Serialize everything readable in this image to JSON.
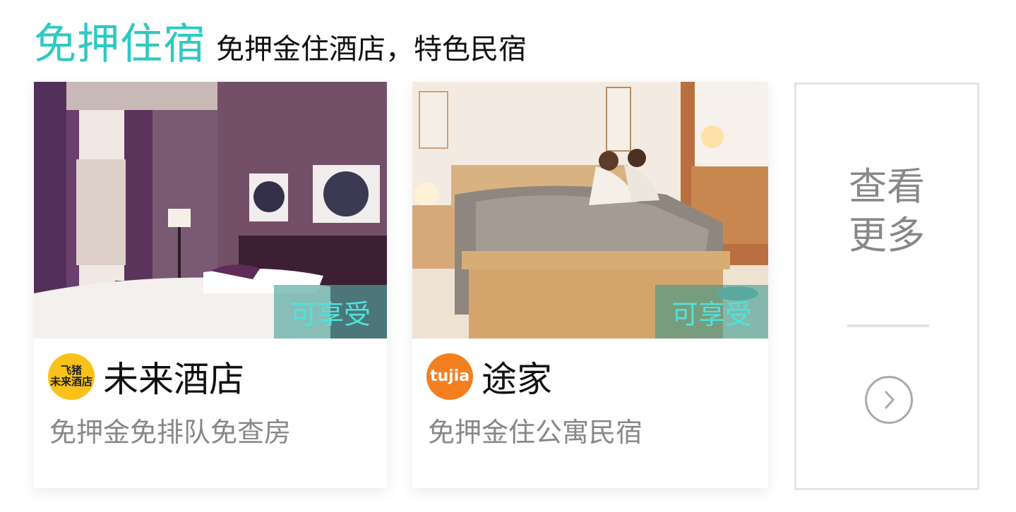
{
  "header": {
    "title": "免押住宿",
    "subtitle": "免押金住酒店，特色民宿"
  },
  "cards": [
    {
      "badge": "可享受",
      "logo_text": [
        "飞猪",
        "未来酒店"
      ],
      "name": "未来酒店",
      "desc": "免押金免排队免查房",
      "accent": "#f8c21a"
    },
    {
      "badge": "可享受",
      "logo_text": [
        "tujia"
      ],
      "name": "途家",
      "desc": "免押金住公寓民宿",
      "accent": "#f47f1f"
    }
  ],
  "more": {
    "line1": "查看",
    "line2": "更多",
    "arrow_icon": "chevron-right-icon"
  },
  "colors": {
    "title": "#2ec9c2",
    "badge_text": "#4fe3da"
  }
}
